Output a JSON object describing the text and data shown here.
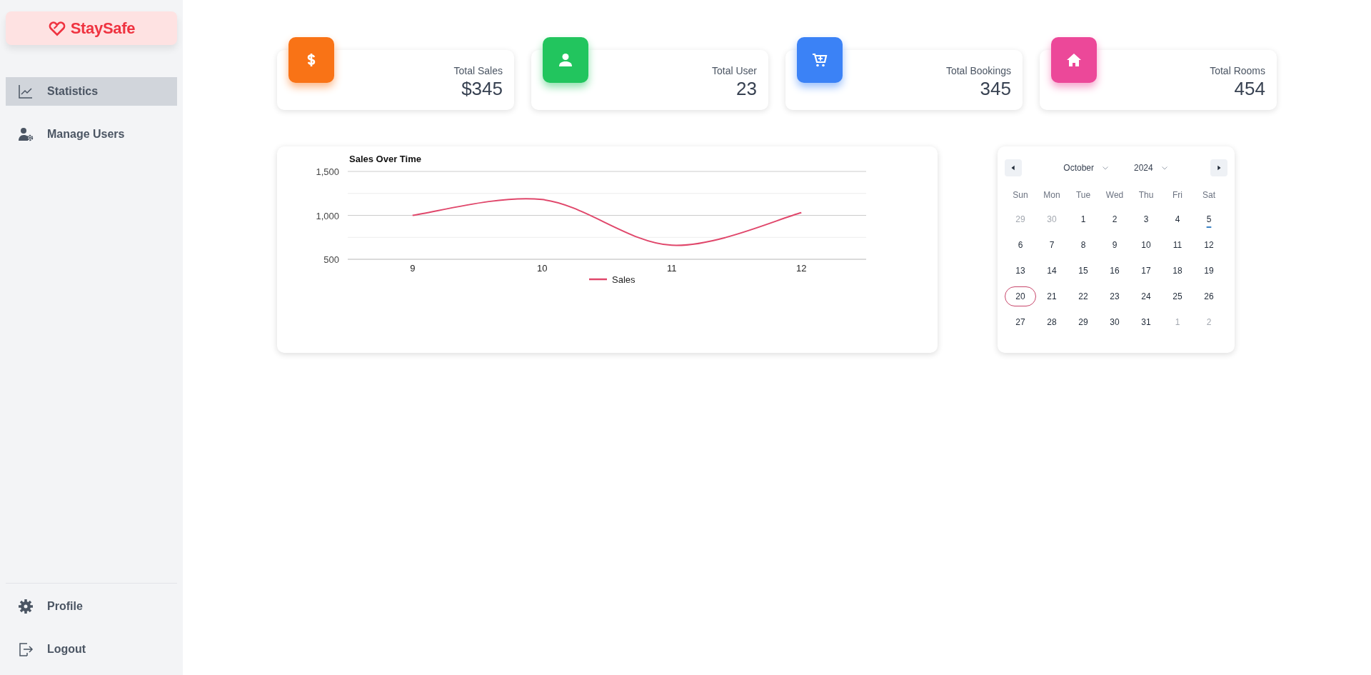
{
  "sidebar": {
    "logo": "StaySafe",
    "items": [
      {
        "kind": "statistics",
        "label": "Statistics",
        "selected": true
      },
      {
        "kind": "users",
        "label": "Manage Users",
        "selected": false
      }
    ],
    "footer_items": [
      {
        "kind": "profile",
        "label": "Profile"
      },
      {
        "kind": "logout",
        "label": "Logout"
      }
    ]
  },
  "stats": [
    {
      "kind": "sales",
      "label": "Total Sales",
      "value": "$345",
      "color": "#f97316"
    },
    {
      "kind": "users",
      "label": "Total User",
      "value": "23",
      "color": "#22c55e"
    },
    {
      "kind": "bookings",
      "label": "Total Bookings",
      "value": "345",
      "color": "#3b82f6"
    },
    {
      "kind": "rooms",
      "label": "Total Rooms",
      "value": "454",
      "color": "#ec4899"
    }
  ],
  "chart": {
    "chart_data": {
      "type": "line",
      "title": "Sales Over Time",
      "categories": [
        "9",
        "10",
        "11",
        "12"
      ],
      "series": [
        {
          "name": "Sales",
          "color": "#e0476b",
          "values": [
            1000,
            1180,
            660,
            1030
          ]
        }
      ],
      "ylim": [
        500,
        1500
      ],
      "ref_lines": [
        {
          "axis": "y",
          "value": 750
        },
        {
          "axis": "y",
          "value": 1250
        }
      ],
      "yticks": [
        {
          "value": 500,
          "label": "500"
        },
        {
          "value": 1000,
          "label": "1,000"
        },
        {
          "value": 1500,
          "label": "1,500"
        }
      ]
    }
  },
  "calendar": {
    "month": "October",
    "year": "2024",
    "weekdays": [
      "Sun",
      "Mon",
      "Tue",
      "Wed",
      "Thu",
      "Fri",
      "Sat"
    ],
    "weeks": [
      [
        {
          "label": "29",
          "muted": true,
          "selected": false,
          "today": false
        },
        {
          "label": "30",
          "muted": true,
          "selected": false,
          "today": false
        },
        {
          "label": "1",
          "muted": false,
          "selected": false,
          "today": false
        },
        {
          "label": "2",
          "muted": false,
          "selected": false,
          "today": false
        },
        {
          "label": "3",
          "muted": false,
          "selected": false,
          "today": false
        },
        {
          "label": "4",
          "muted": false,
          "selected": false,
          "today": false
        },
        {
          "label": "5",
          "muted": false,
          "selected": false,
          "today": true
        }
      ],
      [
        {
          "label": "6",
          "muted": false,
          "selected": false,
          "today": false
        },
        {
          "label": "7",
          "muted": false,
          "selected": false,
          "today": false
        },
        {
          "label": "8",
          "muted": false,
          "selected": false,
          "today": false
        },
        {
          "label": "9",
          "muted": false,
          "selected": false,
          "today": false
        },
        {
          "label": "10",
          "muted": false,
          "selected": false,
          "today": false
        },
        {
          "label": "11",
          "muted": false,
          "selected": false,
          "today": false
        },
        {
          "label": "12",
          "muted": false,
          "selected": false,
          "today": false
        }
      ],
      [
        {
          "label": "13",
          "muted": false,
          "selected": false,
          "today": false
        },
        {
          "label": "14",
          "muted": false,
          "selected": false,
          "today": false
        },
        {
          "label": "15",
          "muted": false,
          "selected": false,
          "today": false
        },
        {
          "label": "16",
          "muted": false,
          "selected": false,
          "today": false
        },
        {
          "label": "17",
          "muted": false,
          "selected": false,
          "today": false
        },
        {
          "label": "18",
          "muted": false,
          "selected": false,
          "today": false
        },
        {
          "label": "19",
          "muted": false,
          "selected": false,
          "today": false
        }
      ],
      [
        {
          "label": "20",
          "muted": false,
          "selected": true,
          "today": false
        },
        {
          "label": "21",
          "muted": false,
          "selected": false,
          "today": false
        },
        {
          "label": "22",
          "muted": false,
          "selected": false,
          "today": false
        },
        {
          "label": "23",
          "muted": false,
          "selected": false,
          "today": false
        },
        {
          "label": "24",
          "muted": false,
          "selected": false,
          "today": false
        },
        {
          "label": "25",
          "muted": false,
          "selected": false,
          "today": false
        },
        {
          "label": "26",
          "muted": false,
          "selected": false,
          "today": false
        }
      ],
      [
        {
          "label": "27",
          "muted": false,
          "selected": false,
          "today": false
        },
        {
          "label": "28",
          "muted": false,
          "selected": false,
          "today": false
        },
        {
          "label": "29",
          "muted": false,
          "selected": false,
          "today": false
        },
        {
          "label": "30",
          "muted": false,
          "selected": false,
          "today": false
        },
        {
          "label": "31",
          "muted": false,
          "selected": false,
          "today": false
        },
        {
          "label": "1",
          "muted": true,
          "selected": false,
          "today": false
        },
        {
          "label": "2",
          "muted": true,
          "selected": false,
          "today": false
        }
      ]
    ]
  }
}
